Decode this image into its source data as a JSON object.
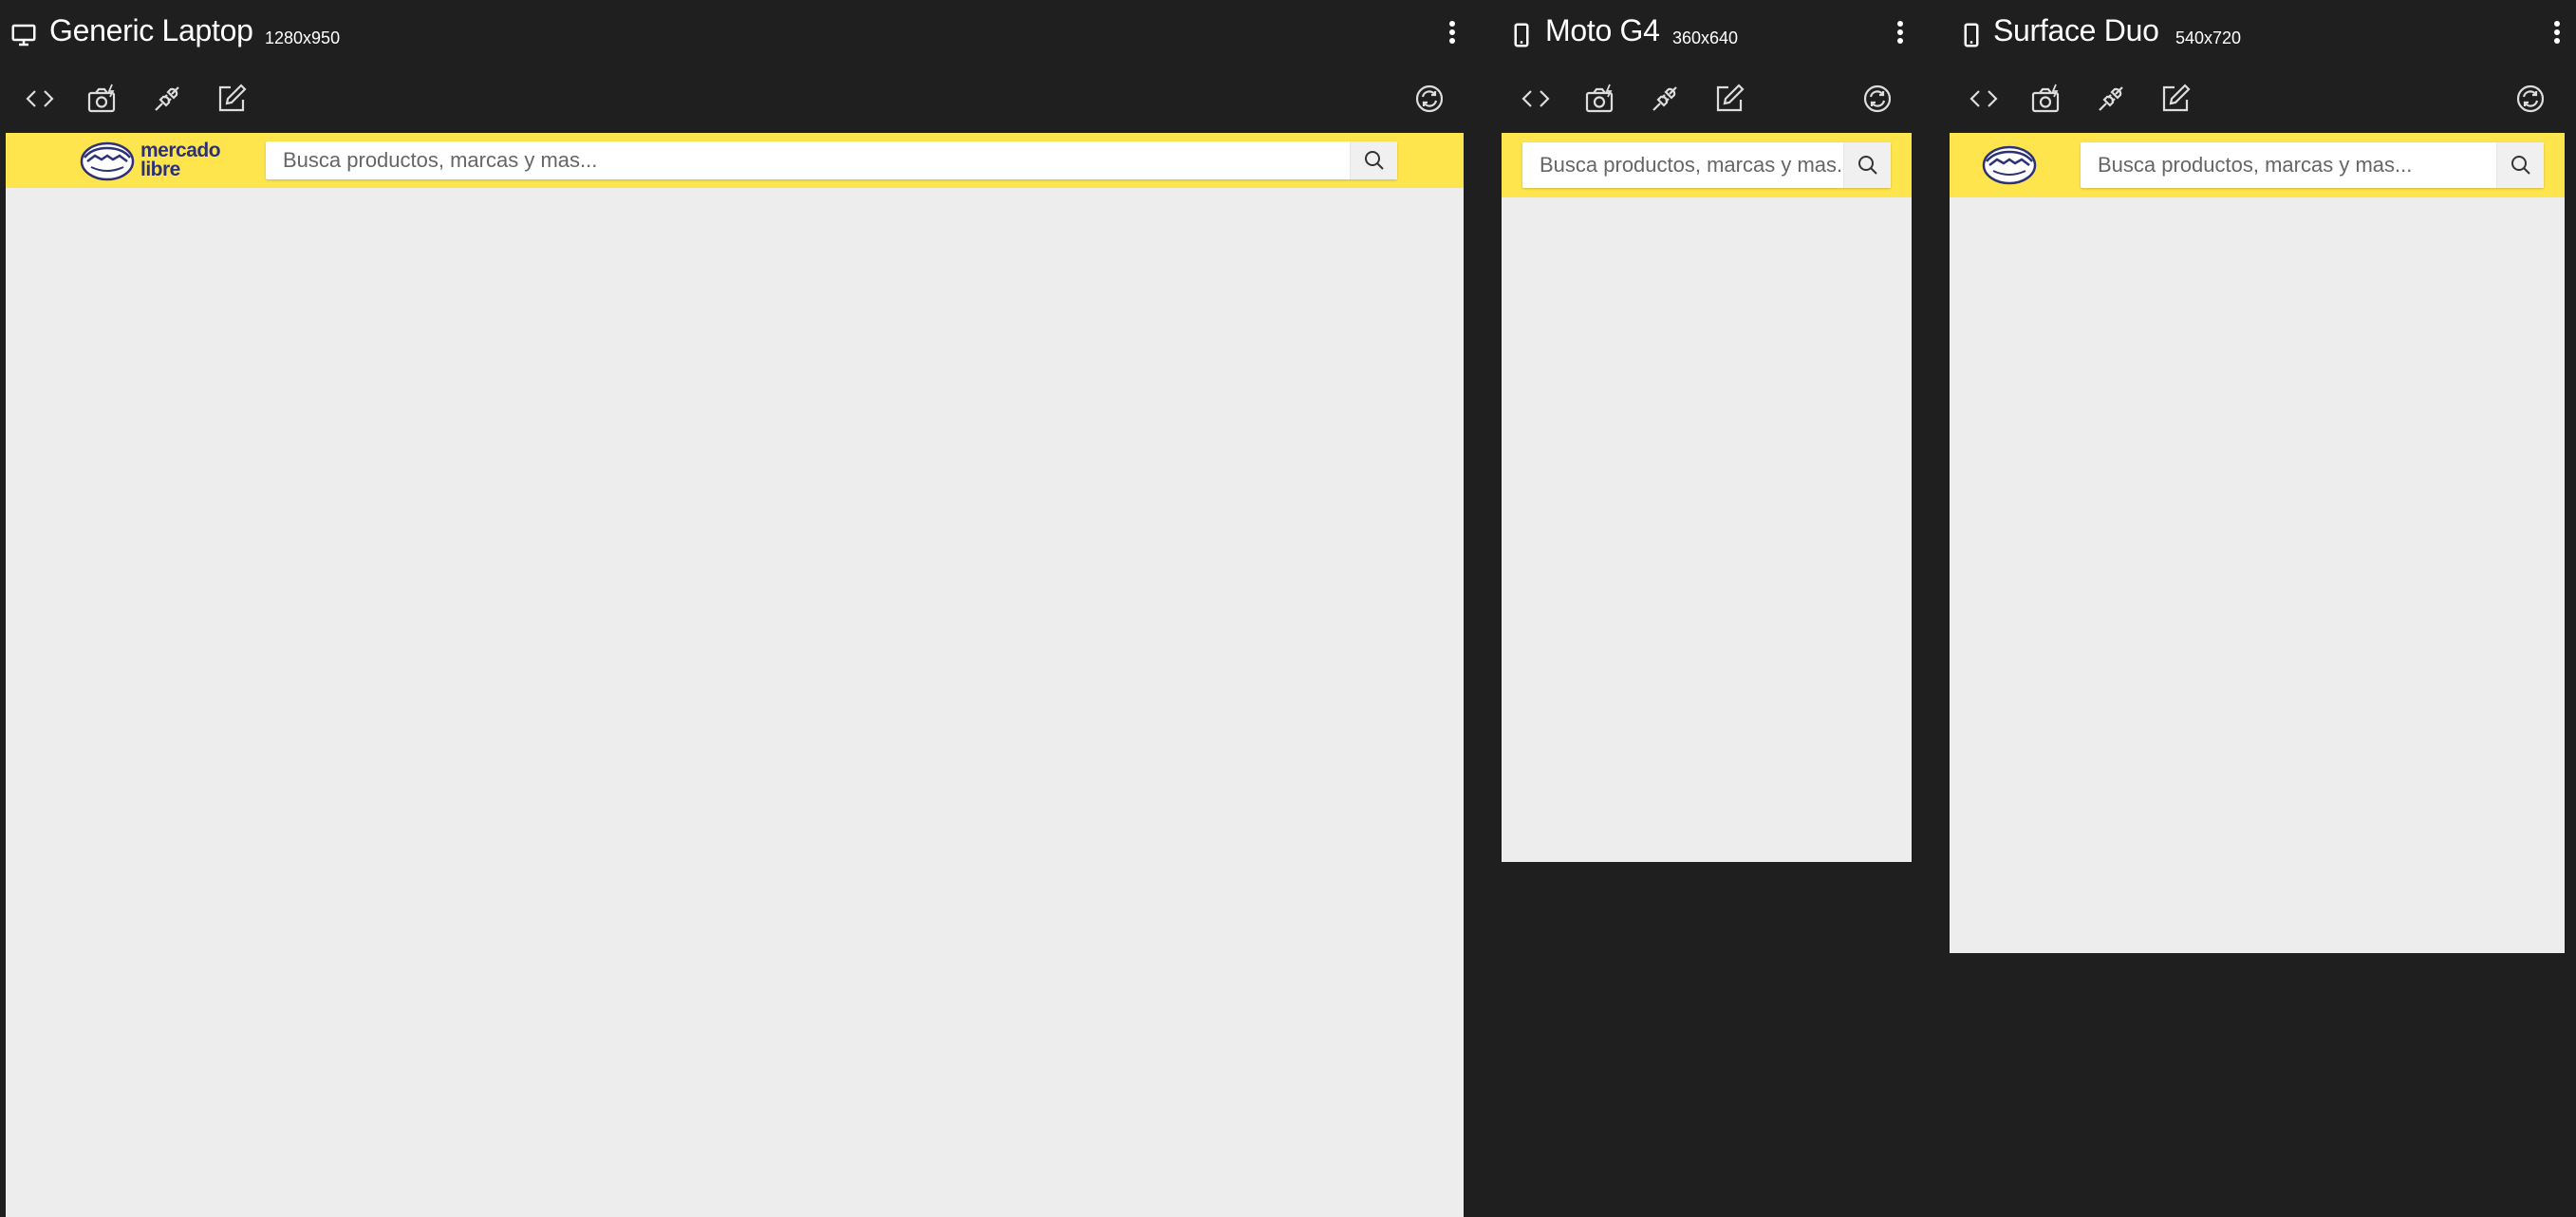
{
  "devices": [
    {
      "name": "Generic Laptop",
      "size": "1280x950",
      "device_icon": "laptop-icon",
      "logo_text": [
        "mercado",
        "libre"
      ],
      "search_placeholder": "Busca productos, marcas y mas..."
    },
    {
      "name": "Moto G4",
      "size": "360x640",
      "device_icon": "phone-icon",
      "search_placeholder": "Busca productos, marcas y mas..."
    },
    {
      "name": "Surface Duo",
      "size": "540x720",
      "device_icon": "phone-icon",
      "search_placeholder": "Busca productos, marcas y mas..."
    }
  ],
  "toolbar_icons": [
    "code-icon",
    "camera-icon",
    "plug-icon",
    "edit-icon",
    "rotate-icon"
  ],
  "colors": {
    "background": "#1f1f1f",
    "viewport": "#ededed",
    "brand_yellow": "#fee44d",
    "brand_navy": "#2d3277"
  }
}
